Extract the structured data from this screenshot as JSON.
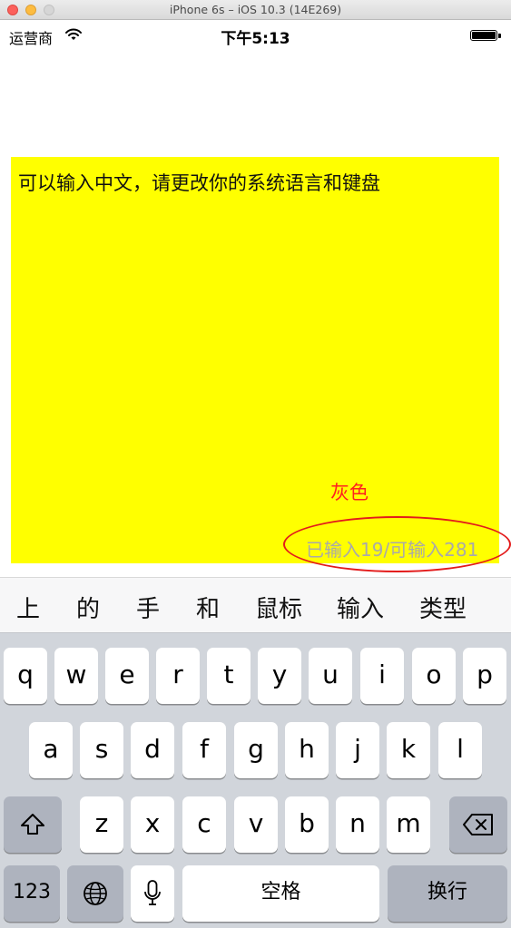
{
  "window": {
    "title": "iPhone 6s – iOS 10.3 (14E269)"
  },
  "statusbar": {
    "carrier": "运营商",
    "time": "下午5:13"
  },
  "textview": {
    "content": "可以输入中文，请更改你的系统语言和键盘",
    "annotation": "灰色",
    "counter": "已输入19/可输入281",
    "background": "#ffff00"
  },
  "candidates": [
    "上",
    "的",
    "手",
    "和",
    "鼠标",
    "输入",
    "类型"
  ],
  "keyboard": {
    "row1": [
      "q",
      "w",
      "e",
      "r",
      "t",
      "y",
      "u",
      "i",
      "o",
      "p"
    ],
    "row2": [
      "a",
      "s",
      "d",
      "f",
      "g",
      "h",
      "j",
      "k",
      "l"
    ],
    "row3": [
      "z",
      "x",
      "c",
      "v",
      "b",
      "n",
      "m"
    ],
    "numbers_label": "123",
    "space_label": "空格",
    "return_label": "换行",
    "shift_icon": "shift-icon",
    "delete_icon": "delete-icon",
    "globe_icon": "globe-icon",
    "mic_icon": "microphone-icon"
  }
}
